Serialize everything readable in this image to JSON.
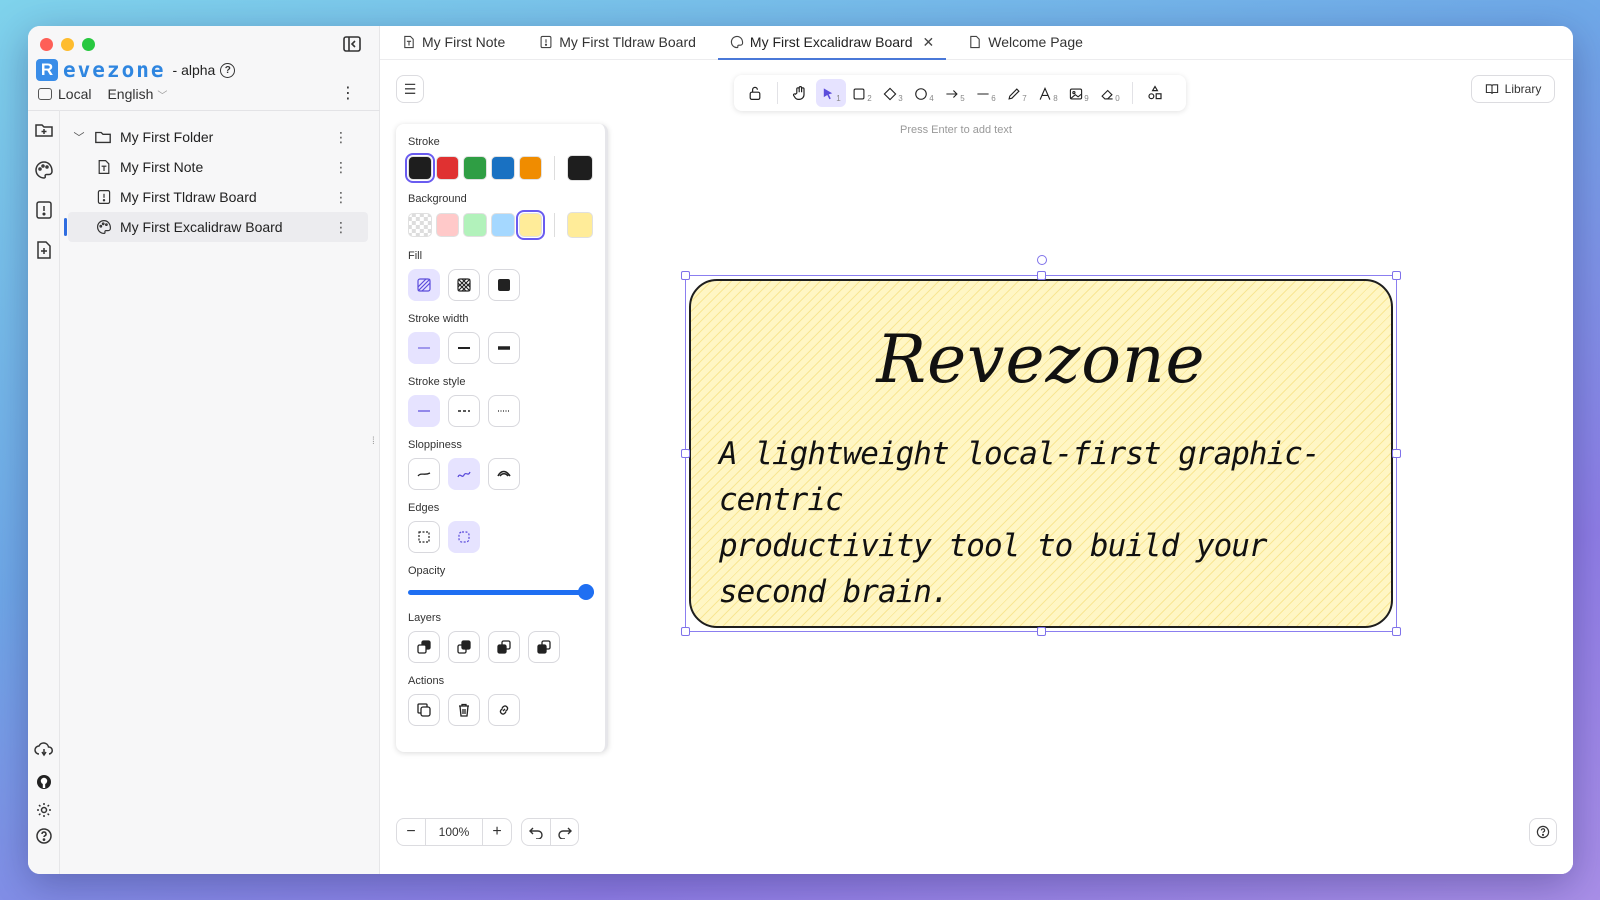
{
  "sidebar": {
    "brand": {
      "letter": "R",
      "word": "evezone",
      "suffix": "- alpha"
    },
    "storage": "Local",
    "language": "English",
    "tree": [
      {
        "label": "My First Folder",
        "type": "folder"
      },
      {
        "label": "My First Note",
        "type": "note"
      },
      {
        "label": "My First Tldraw Board",
        "type": "tldraw"
      },
      {
        "label": "My First Excalidraw Board",
        "type": "excalidraw",
        "active": true
      }
    ]
  },
  "tabs": [
    {
      "label": "My First Note",
      "icon": "note-icon"
    },
    {
      "label": "My First Tldraw Board",
      "icon": "tldraw-icon"
    },
    {
      "label": "My First Excalidraw Board",
      "icon": "palette-icon",
      "active": true,
      "close": "✕"
    },
    {
      "label": "Welcome Page",
      "icon": "page-icon"
    }
  ],
  "toolbar": {
    "numbers": [
      "1",
      "2",
      "3",
      "4",
      "5",
      "6",
      "7",
      "8",
      "9",
      "0"
    ],
    "hint": "Press Enter to add text",
    "library_label": "Library"
  },
  "properties": {
    "stroke_label": "Stroke",
    "stroke_colors": [
      "#1e1e1e",
      "#e03131",
      "#2f9e44",
      "#1971c2",
      "#f08c00"
    ],
    "stroke_current": "#1e1e1e",
    "background_label": "Background",
    "background_colors": [
      "transparent",
      "#ffc9c9",
      "#b2f2bb",
      "#a5d8ff",
      "#ffec99"
    ],
    "background_current": "#ffec99",
    "fill_label": "Fill",
    "stroke_width_label": "Stroke width",
    "stroke_style_label": "Stroke style",
    "sloppiness_label": "Sloppiness",
    "edges_label": "Edges",
    "opacity_label": "Opacity",
    "opacity_value": 100,
    "layers_label": "Layers",
    "actions_label": "Actions"
  },
  "card": {
    "title": "Revezone",
    "body_line1": "A lightweight local-first graphic-centric",
    "body_line2": "productivity tool to build your second brain."
  },
  "zoom": {
    "value": "100%",
    "minus": "−",
    "plus": "+"
  },
  "colors": {
    "accent": "#6a5cf0",
    "brand": "#2f86e0",
    "slider": "#1f6ff2"
  }
}
